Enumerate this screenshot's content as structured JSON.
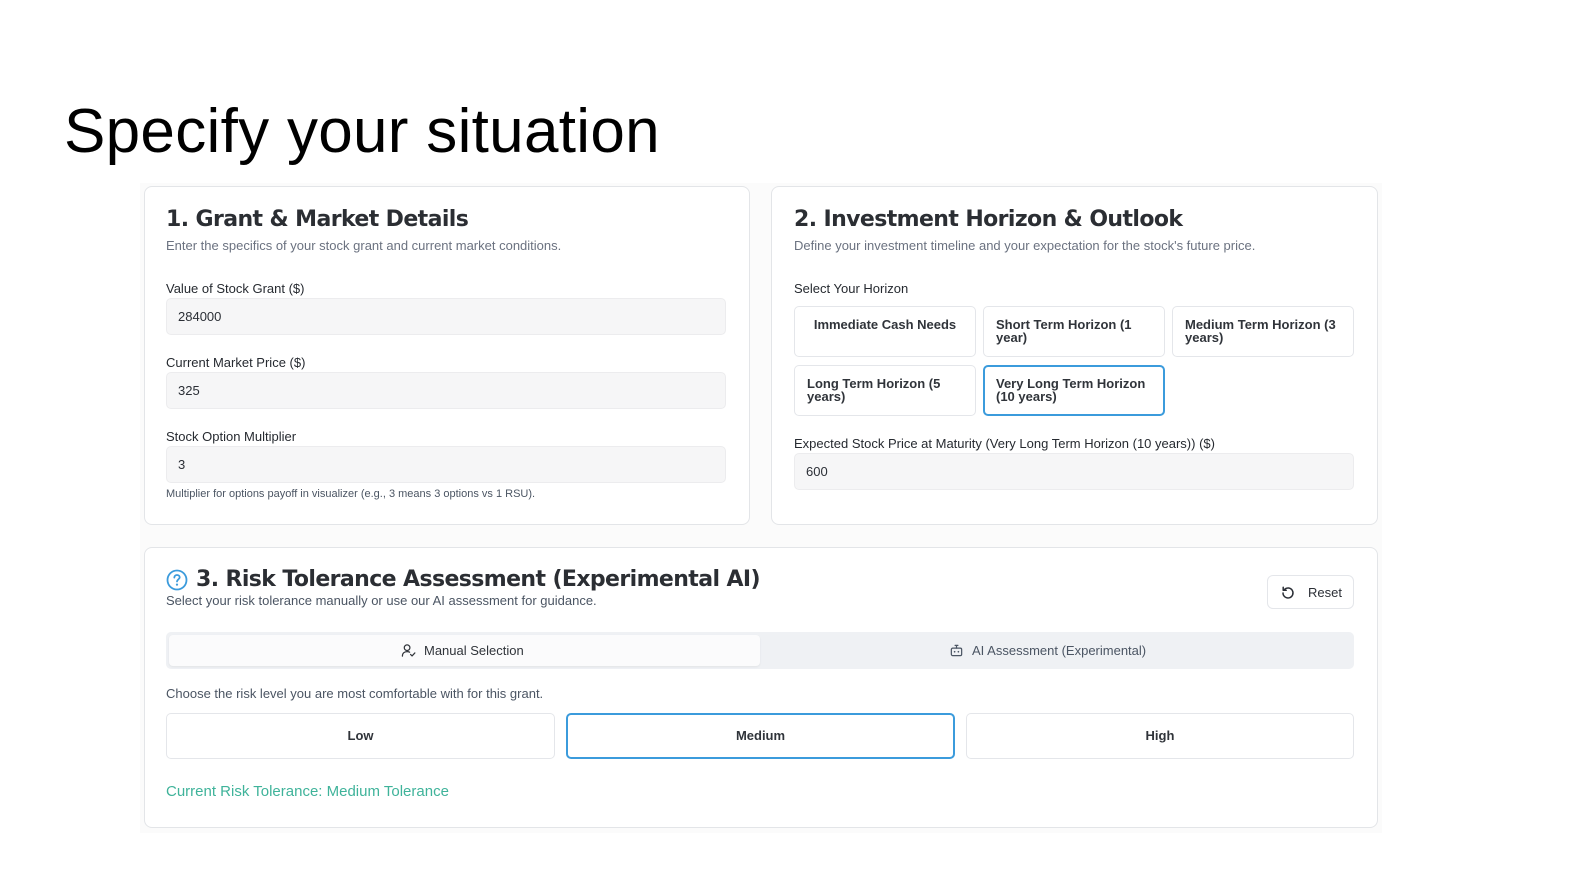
{
  "page": {
    "title": "Specify your situation"
  },
  "grant_card": {
    "title": "1. Grant & Market Details",
    "subtitle": "Enter the specifics of your stock grant and current market conditions.",
    "fields": [
      {
        "label": "Value of Stock Grant ($)",
        "value": "284000"
      },
      {
        "label": "Current Market Price ($)",
        "value": "325"
      },
      {
        "label": "Stock Option Multiplier",
        "value": "3"
      }
    ],
    "multiplier_hint": "Multiplier for options payoff in visualizer (e.g., 3 means 3 options vs 1 RSU)."
  },
  "horizon_card": {
    "title": "2. Investment Horizon & Outlook",
    "subtitle": "Define your investment timeline and your expectation for the stock's future price.",
    "select_label": "Select Your Horizon",
    "options": [
      {
        "label": "Immediate Cash Needs",
        "selected": false
      },
      {
        "label": "Short Term Horizon (1 year)",
        "selected": false
      },
      {
        "label": "Medium Term Horizon (3 years)",
        "selected": false
      },
      {
        "label": "Long Term Horizon (5 years)",
        "selected": false
      },
      {
        "label": "Very Long Term Horizon (10 years)",
        "selected": true
      }
    ],
    "expected_label": "Expected Stock Price at Maturity (Very Long Term Horizon (10 years)) ($)",
    "expected_value": "600"
  },
  "risk_card": {
    "title": "3. Risk Tolerance Assessment (Experimental AI)",
    "subtitle": "Select your risk tolerance manually or use our AI assessment for guidance.",
    "reset_label": "Reset",
    "tabs": [
      {
        "label": "Manual Selection",
        "icon": "user-check-icon",
        "active": true
      },
      {
        "label": "AI Assessment (Experimental)",
        "icon": "bot-icon",
        "active": false
      }
    ],
    "prompt": "Choose the risk level you are most comfortable with for this grant.",
    "levels": [
      {
        "label": "Low",
        "selected": false
      },
      {
        "label": "Medium",
        "selected": true
      },
      {
        "label": "High",
        "selected": false
      }
    ],
    "current_status": "Current Risk Tolerance: Medium Tolerance"
  },
  "colors": {
    "accent_blue": "#3b9bdc",
    "status_green": "#3fb39a",
    "help_icon": "#3b9bdc"
  }
}
